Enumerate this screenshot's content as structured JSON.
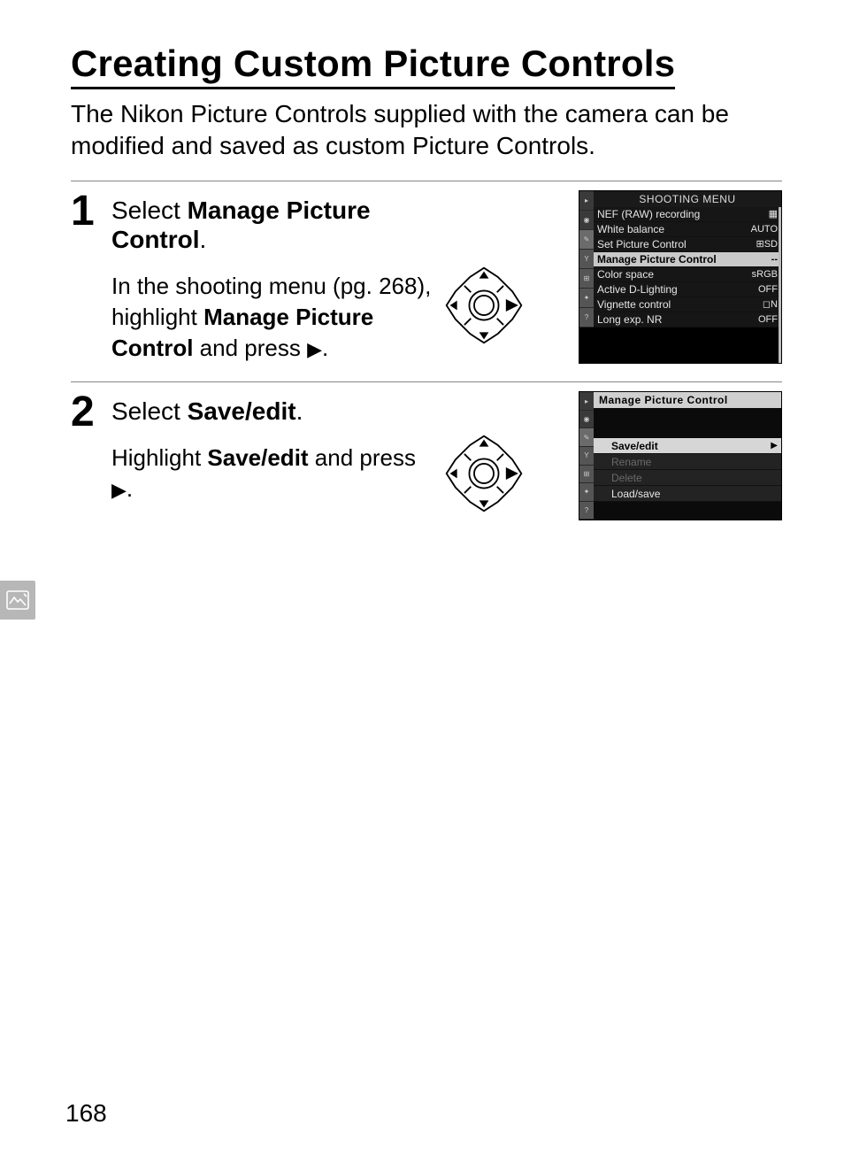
{
  "page_number": "168",
  "heading": "Creating Custom Picture Controls",
  "intro": "The Nikon Picture Controls supplied with the camera can be modified and saved as custom Picture Controls.",
  "steps": [
    {
      "num": "1",
      "title_lead": "Select ",
      "title_bold": "Manage Picture Control",
      "title_tail": ".",
      "desc_pre": "In the shooting menu (pg. 268), highlight ",
      "desc_bold": "Manage Picture Control",
      "desc_post": " and press ",
      "desc_glyph": "▶",
      "desc_end": "."
    },
    {
      "num": "2",
      "title_lead": "Select ",
      "title_bold": "Save/edit",
      "title_tail": ".",
      "desc_pre": "Highlight ",
      "desc_bold": "Save/edit",
      "desc_post": " and press ",
      "desc_glyph": "▶",
      "desc_end": "."
    }
  ],
  "lcd1": {
    "title": "SHOOTING MENU",
    "rows": [
      {
        "label": "NEF (RAW) recording",
        "value": "▦"
      },
      {
        "label": "White balance",
        "value": "AUTO"
      },
      {
        "label": "Set Picture Control",
        "value": "⊞SD"
      },
      {
        "label": "Manage Picture Control",
        "value": "--",
        "hl": true
      },
      {
        "label": "Color space",
        "value": "sRGB"
      },
      {
        "label": "Active D-Lighting",
        "value": "OFF"
      },
      {
        "label": "Vignette control",
        "value": "◻N"
      },
      {
        "label": "Long exp. NR",
        "value": "OFF"
      }
    ]
  },
  "lcd2": {
    "title": "Manage Picture Control",
    "rows": [
      {
        "label": "Save/edit",
        "hl": true
      },
      {
        "label": "Rename",
        "dim": true
      },
      {
        "label": "Delete",
        "dim": true
      },
      {
        "label": "Load/save"
      }
    ]
  }
}
